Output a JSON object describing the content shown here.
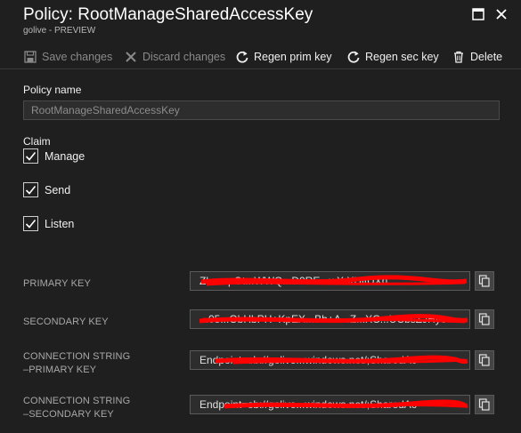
{
  "header": {
    "title": "Policy: RootManageSharedAccessKey",
    "subtitle": "golive - PREVIEW"
  },
  "toolbar": {
    "save_label": "Save changes",
    "discard_label": "Discard changes",
    "regen_prim_label": "Regen prim key",
    "regen_sec_label": "Regen sec key",
    "delete_label": "Delete"
  },
  "policy": {
    "label": "Policy name",
    "value": "RootManageSharedAccessKey"
  },
  "claim": {
    "label": "Claim",
    "items": [
      {
        "label": "Manage",
        "checked": true
      },
      {
        "label": "Send",
        "checked": true
      },
      {
        "label": "Listen",
        "checked": true
      }
    ]
  },
  "keys": {
    "primary_key": {
      "label": "PRIMARY KEY",
      "value": "Zk...wpGt...WWQ...D0RE...wX.XUlIUXn..."
    },
    "secondary_key": {
      "label": "SECONDARY KEY",
      "value": "...05...ObHbPH+KpEX...Bh+A...Z...XC...UCbsZJHyo"
    },
    "conn_primary": {
      "label_line1": "CONNECTION STRING",
      "label_line2": "–PRIMARY KEY",
      "value": "Endpoint=sb://golive...windows.net/;SharedAc"
    },
    "conn_secondary": {
      "label_line1": "CONNECTION STRING",
      "label_line2": "–SECONDARY KEY",
      "value": "Endpoint=sb://golive...windows.net/;SharedAc"
    }
  },
  "colors": {
    "background": "#1f1f1f",
    "redaction": "#ff0000",
    "text": "#f0f0f0",
    "muted": "#8a8a8a"
  }
}
